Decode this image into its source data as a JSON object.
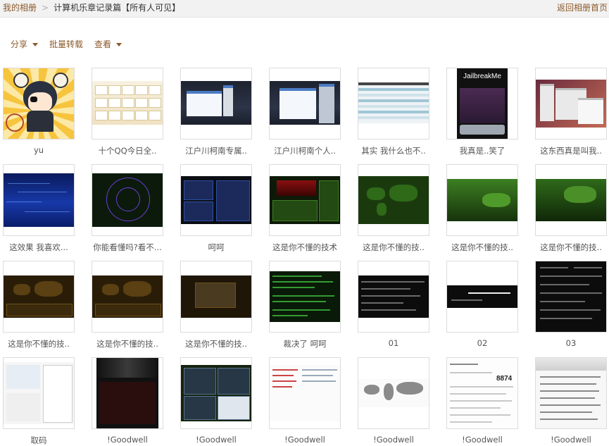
{
  "breadcrumb": {
    "home": "我的相册",
    "separator": ">",
    "current": "计算机乐章记录篇【所有人可见】",
    "back": "返回相册首页"
  },
  "toolbar": {
    "share": "分享",
    "batch": "批量转载",
    "view": "查看"
  },
  "photos": [
    {
      "caption": "yu"
    },
    {
      "caption": "十个QQ今日全.."
    },
    {
      "caption": "江户川柯南专属.."
    },
    {
      "caption": "江户川柯南个人.."
    },
    {
      "caption": "其实 我什么也不.."
    },
    {
      "caption": "我真是..笑了",
      "thumb_text": "JailbreakMe"
    },
    {
      "caption": "这东西真是叫我.."
    },
    {
      "caption": "这效果 我喜欢..."
    },
    {
      "caption": "你能看懂吗?看不..."
    },
    {
      "caption": "呵呵"
    },
    {
      "caption": "这是你不懂的技术"
    },
    {
      "caption": "这是你不懂的技.."
    },
    {
      "caption": "这是你不懂的技.."
    },
    {
      "caption": "这是你不懂的技.."
    },
    {
      "caption": "这是你不懂的技.."
    },
    {
      "caption": "这是你不懂的技.."
    },
    {
      "caption": "这是你不懂的技.."
    },
    {
      "caption": "裁决了 呵呵"
    },
    {
      "caption": "01"
    },
    {
      "caption": "02"
    },
    {
      "caption": "03"
    },
    {
      "caption": "取码"
    },
    {
      "caption": "!Goodwell"
    },
    {
      "caption": "!Goodwell"
    },
    {
      "caption": "!Goodwell"
    },
    {
      "caption": "!Goodwell"
    },
    {
      "caption": "!Goodwell",
      "thumb_text": "8874"
    },
    {
      "caption": "!Goodwell"
    }
  ]
}
